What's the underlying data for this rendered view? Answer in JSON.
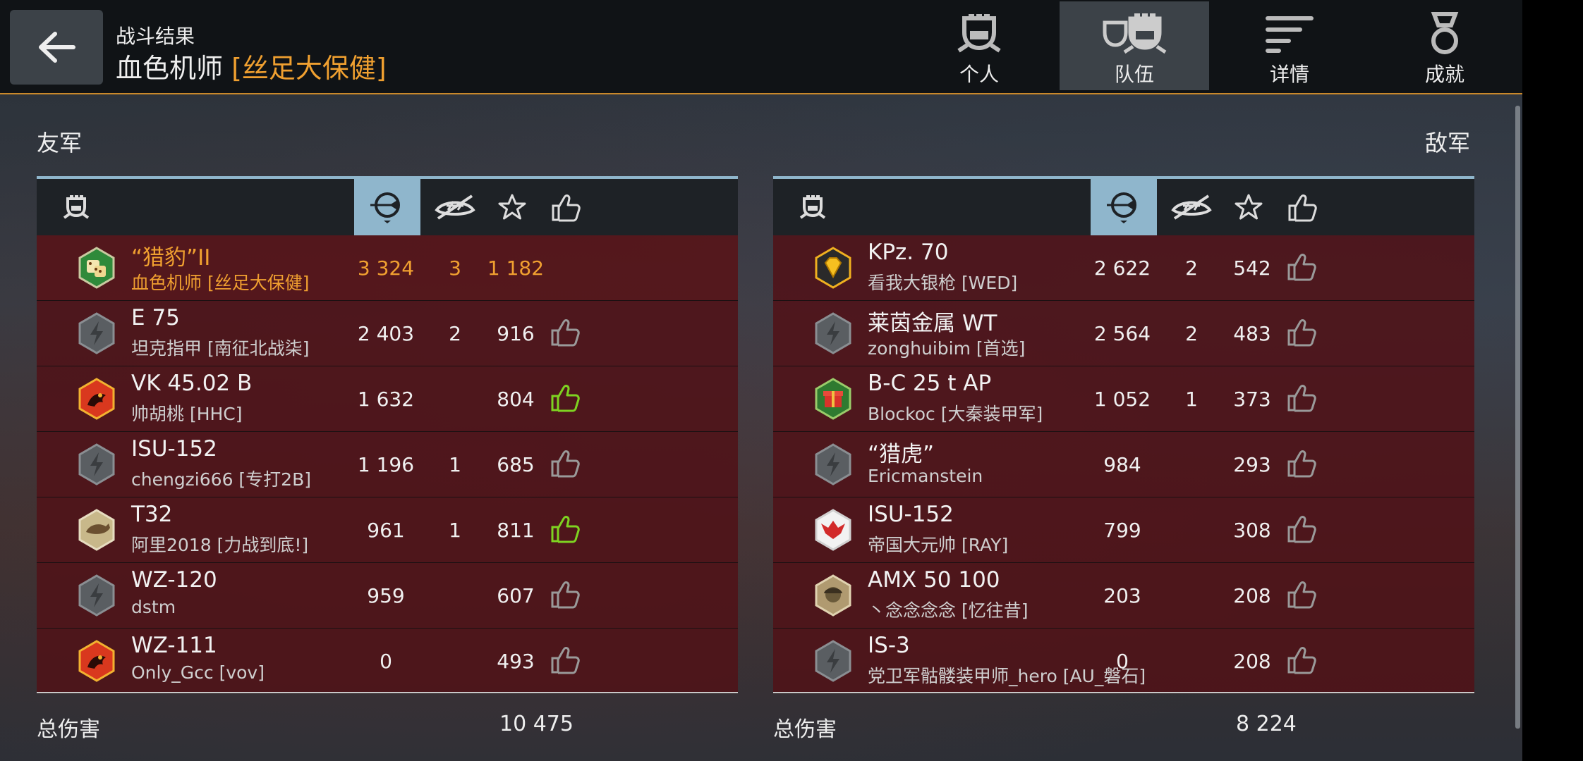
{
  "header": {
    "subtitle": "战斗结果",
    "player_name": "血色机师",
    "player_clan": "[丝足大保健]",
    "tabs": [
      {
        "label": "个人",
        "icon": "personal-helmet-icon",
        "active": false
      },
      {
        "label": "队伍",
        "icon": "team-helmets-icon",
        "active": true
      },
      {
        "label": "详情",
        "icon": "details-lines-icon",
        "active": false
      },
      {
        "label": "成就",
        "icon": "medal-icon",
        "active": false
      }
    ]
  },
  "allies": {
    "label": "友军",
    "total_label": "总伤害",
    "total": "10 475",
    "rows": [
      {
        "tank": "“猎豹”II",
        "player": "血色机师 [丝足大保健]",
        "damage": "3 324",
        "kills": "3",
        "score": "1 182",
        "badge": "dice",
        "like": "none",
        "self": true
      },
      {
        "tank": "E 75",
        "player": "坦克指甲 [南征北战柒]",
        "damage": "2 403",
        "kills": "2",
        "score": "916",
        "badge": "gray",
        "like": "gray",
        "self": false
      },
      {
        "tank": "VK 45.02 B",
        "player": "帅胡桃 [HHC]",
        "damage": "1 632",
        "kills": "",
        "score": "804",
        "badge": "dragon",
        "like": "green",
        "self": false
      },
      {
        "tank": "ISU-152",
        "player": "chengzi666 [专打2B]",
        "damage": "1 196",
        "kills": "1",
        "score": "685",
        "badge": "gray",
        "like": "gray",
        "self": false
      },
      {
        "tank": "T32",
        "player": "阿里2018 [力战到底!]",
        "damage": "961",
        "kills": "1",
        "score": "811",
        "badge": "tan",
        "like": "green",
        "self": false
      },
      {
        "tank": "WZ-120",
        "player": "dstm",
        "damage": "959",
        "kills": "",
        "score": "607",
        "badge": "gray",
        "like": "gray",
        "self": false
      },
      {
        "tank": "WZ-111",
        "player": "Only_Gcc [vov]",
        "damage": "0",
        "kills": "",
        "score": "493",
        "badge": "dragon",
        "like": "gray",
        "self": false
      }
    ]
  },
  "enemies": {
    "label": "敌军",
    "total_label": "总伤害",
    "total": "8 224",
    "rows": [
      {
        "tank": "KPz. 70",
        "player": "看我大银枪 [WED]",
        "damage": "2 622",
        "kills": "2",
        "score": "542",
        "badge": "diamond",
        "like": "gray"
      },
      {
        "tank": "莱茵金属 WT",
        "player": "zonghuibim [首选]",
        "damage": "2 564",
        "kills": "2",
        "score": "483",
        "badge": "gray",
        "like": "gray"
      },
      {
        "tank": "B-C 25 t AP",
        "player": "Blockoc [大秦装甲军]",
        "damage": "1 052",
        "kills": "1",
        "score": "373",
        "badge": "gift",
        "like": "gray"
      },
      {
        "tank": "“猎虎”",
        "player": "Ericmanstein",
        "damage": "984",
        "kills": "",
        "score": "293",
        "badge": "gray",
        "like": "gray"
      },
      {
        "tank": "ISU-152",
        "player": "帝国大元帅 [RAY]",
        "damage": "799",
        "kills": "",
        "score": "308",
        "badge": "eagle",
        "like": "gray"
      },
      {
        "tank": "AMX 50 100",
        "player": "丶念念念念 [忆往昔]",
        "damage": "203",
        "kills": "",
        "score": "208",
        "badge": "soldier",
        "like": "gray"
      },
      {
        "tank": "IS-3",
        "player": "党卫军骷髅装甲师_hero [AU_磐石]",
        "damage": "0",
        "kills": "",
        "score": "208",
        "badge": "gray",
        "like": "gray"
      }
    ]
  },
  "colors": {
    "accent": "#f0a030",
    "row_bg": "#501218",
    "header_active": "#8fb6cc",
    "like_green": "#7ed321",
    "like_gray": "#9a9a9a"
  }
}
